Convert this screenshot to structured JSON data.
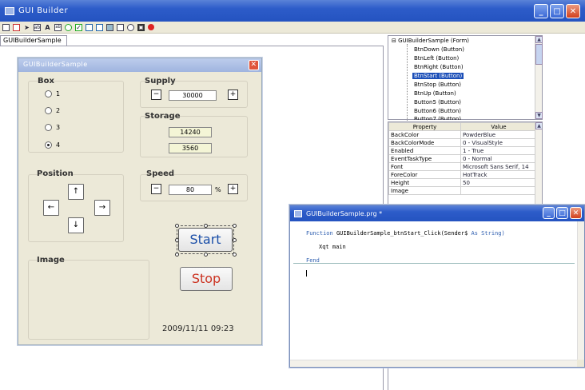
{
  "window": {
    "title": "GUI Builder"
  },
  "toolbar": {
    "icons": [
      "form-icon",
      "new-icon",
      "pointer-icon",
      "button-icon",
      "label-icon",
      "textbox-icon",
      "radio-icon",
      "checkbox-icon",
      "listbox-icon",
      "combobox-icon",
      "picture-icon",
      "frame-icon",
      "timer-icon",
      "camera-icon",
      "stop-icon"
    ]
  },
  "tab": {
    "label": "GUIBuilderSample"
  },
  "form": {
    "title": "GUIBuilderSample",
    "box": {
      "label": "Box",
      "options": [
        "1",
        "2",
        "3",
        "4"
      ],
      "selected": "4"
    },
    "supply": {
      "label": "Supply",
      "minus": "−",
      "value": "30000",
      "plus": "+"
    },
    "storage": {
      "label": "Storage",
      "value1": "14240",
      "value2": "3560"
    },
    "position": {
      "label": "Position",
      "up": "↑",
      "left": "←",
      "right": "→",
      "down": "↓"
    },
    "speed": {
      "label": "Speed",
      "minus": "−",
      "value": "80",
      "unit": "%",
      "plus": "+"
    },
    "image": {
      "label": "Image"
    },
    "start_label": "Start",
    "stop_label": "Stop",
    "datetime": "2009/11/11  09:23"
  },
  "tree": {
    "root": "⊟ GUIBuilderSample (Form)",
    "items": [
      {
        "label": "BtnDown (Button)"
      },
      {
        "label": "BtnLeft (Button)"
      },
      {
        "label": "BtnRight (Button)"
      },
      {
        "label": "BtnStart (Button)",
        "selected": true
      },
      {
        "label": "BtnStop (Button)"
      },
      {
        "label": "BtnUp (Button)"
      },
      {
        "label": "Button5 (Button)"
      },
      {
        "label": "Button6 (Button)"
      },
      {
        "label": "Button7 (Button)"
      }
    ]
  },
  "properties": {
    "header_property": "Property",
    "header_value": "Value",
    "rows": [
      {
        "name": "BackColor",
        "value": "PowderBlue"
      },
      {
        "name": "BackColorMode",
        "value": "0 - VisualStyle"
      },
      {
        "name": "Enabled",
        "value": "1 - True"
      },
      {
        "name": "EventTaskType",
        "value": "0 - Normal"
      },
      {
        "name": "Font",
        "value": "Microsoft Sans Serif, 14"
      },
      {
        "name": "ForeColor",
        "value": "HotTrack"
      },
      {
        "name": "Height",
        "value": "50"
      },
      {
        "name": "Image",
        "value": ""
      }
    ]
  },
  "editor": {
    "title": "GUIBuilderSample.prg *",
    "line1_kw": "Function",
    "line1_name": "GUIBuilderSample_btnStart_Click(Sender$",
    "line1_as": "As String)",
    "line2": "Xqt main",
    "line3": "Fend"
  }
}
